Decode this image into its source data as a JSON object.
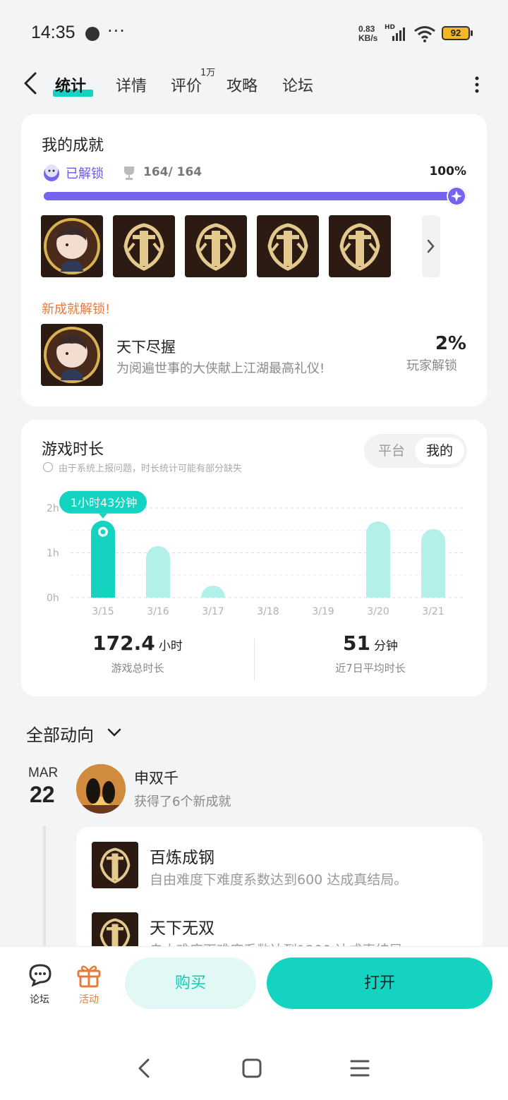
{
  "status": {
    "time": "14:35",
    "dots": "···",
    "speed_value": "0.83",
    "speed_unit": "KB/s",
    "hd": "HD",
    "battery": "92"
  },
  "nav": {
    "tabs": [
      {
        "label": "统计",
        "active": true
      },
      {
        "label": "详情"
      },
      {
        "label": "评价",
        "badge": "1万"
      },
      {
        "label": "攻略"
      },
      {
        "label": "论坛"
      }
    ]
  },
  "achievements": {
    "title": "我的成就",
    "unlocked_label": "已解锁",
    "count": "164/ 164",
    "percent": "100%",
    "progress": 1.0,
    "new_label": "新成就解锁!",
    "new_item": {
      "name": "天下尽握",
      "desc": "为阅遍世事的大侠献上江湖最高礼仪!",
      "rate": "2%",
      "rate_label": "玩家解锁"
    }
  },
  "playtime": {
    "title": "游戏时长",
    "note": "由于系统上报问题，时长统计可能有部分缺失",
    "toggle": [
      "平台",
      "我的"
    ],
    "tooltip": "1小时43分钟",
    "total_value": "172.4",
    "total_unit": "小时",
    "total_label": "游戏总时长",
    "avg_value": "51",
    "avg_unit": "分钟",
    "avg_label": "近7日平均时长"
  },
  "chart_data": {
    "type": "bar",
    "categories": [
      "3/15",
      "3/16",
      "3/17",
      "3/18",
      "3/19",
      "3/20",
      "3/21"
    ],
    "values": [
      1.72,
      1.15,
      0.1,
      0,
      0,
      1.7,
      1.53
    ],
    "y_ticks": [
      "0h",
      "1h",
      "2h"
    ],
    "ylim": [
      0,
      2
    ],
    "highlight_index": 0,
    "colors": {
      "highlight": "#14d4c1",
      "normal": "#b3f0ea"
    }
  },
  "feed": {
    "title": "全部动向",
    "month": "MAR",
    "day": "22",
    "user": "申双千",
    "action": "获得了6个新成就",
    "items": [
      {
        "name": "百炼成钢",
        "desc": "自由难度下难度系数达到600 达成真结局。"
      },
      {
        "name": "天下无双",
        "desc": "自由难度下难度系数达到1200 达成真结局。"
      }
    ]
  },
  "bottom": {
    "forum_label": "论坛",
    "activity_label": "活动",
    "buy_label": "购买",
    "open_label": "打开"
  },
  "colors": {
    "accent": "#14d4c1",
    "purple": "#7664ee",
    "orange": "#e87b3c"
  }
}
